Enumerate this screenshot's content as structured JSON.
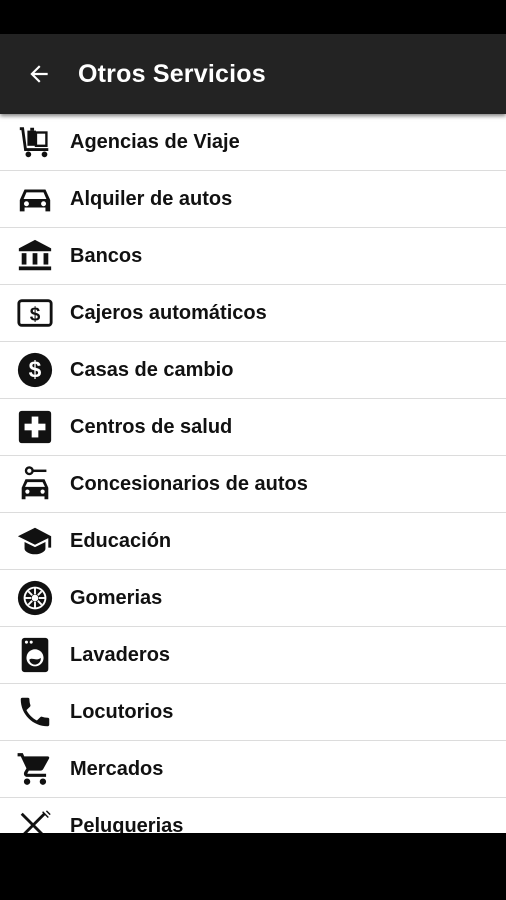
{
  "appbar": {
    "title": "Otros Servicios"
  },
  "items": [
    {
      "label": "Agencias de Viaje",
      "icon": "luggage-cart-icon"
    },
    {
      "label": "Alquiler de autos",
      "icon": "car-icon"
    },
    {
      "label": "Bancos",
      "icon": "bank-icon"
    },
    {
      "label": "Cajeros automáticos",
      "icon": "atm-icon"
    },
    {
      "label": "Casas de cambio",
      "icon": "dollar-circle-icon"
    },
    {
      "label": "Centros de salud",
      "icon": "medical-cross-icon"
    },
    {
      "label": "Concesionarios de autos",
      "icon": "car-key-icon"
    },
    {
      "label": "Educación",
      "icon": "graduation-cap-icon"
    },
    {
      "label": "Gomerias",
      "icon": "tire-icon"
    },
    {
      "label": "Lavaderos",
      "icon": "washing-machine-icon"
    },
    {
      "label": "Locutorios",
      "icon": "phone-icon"
    },
    {
      "label": "Mercados",
      "icon": "cart-icon"
    },
    {
      "label": "Peluquerias",
      "icon": "scissors-comb-icon"
    }
  ]
}
